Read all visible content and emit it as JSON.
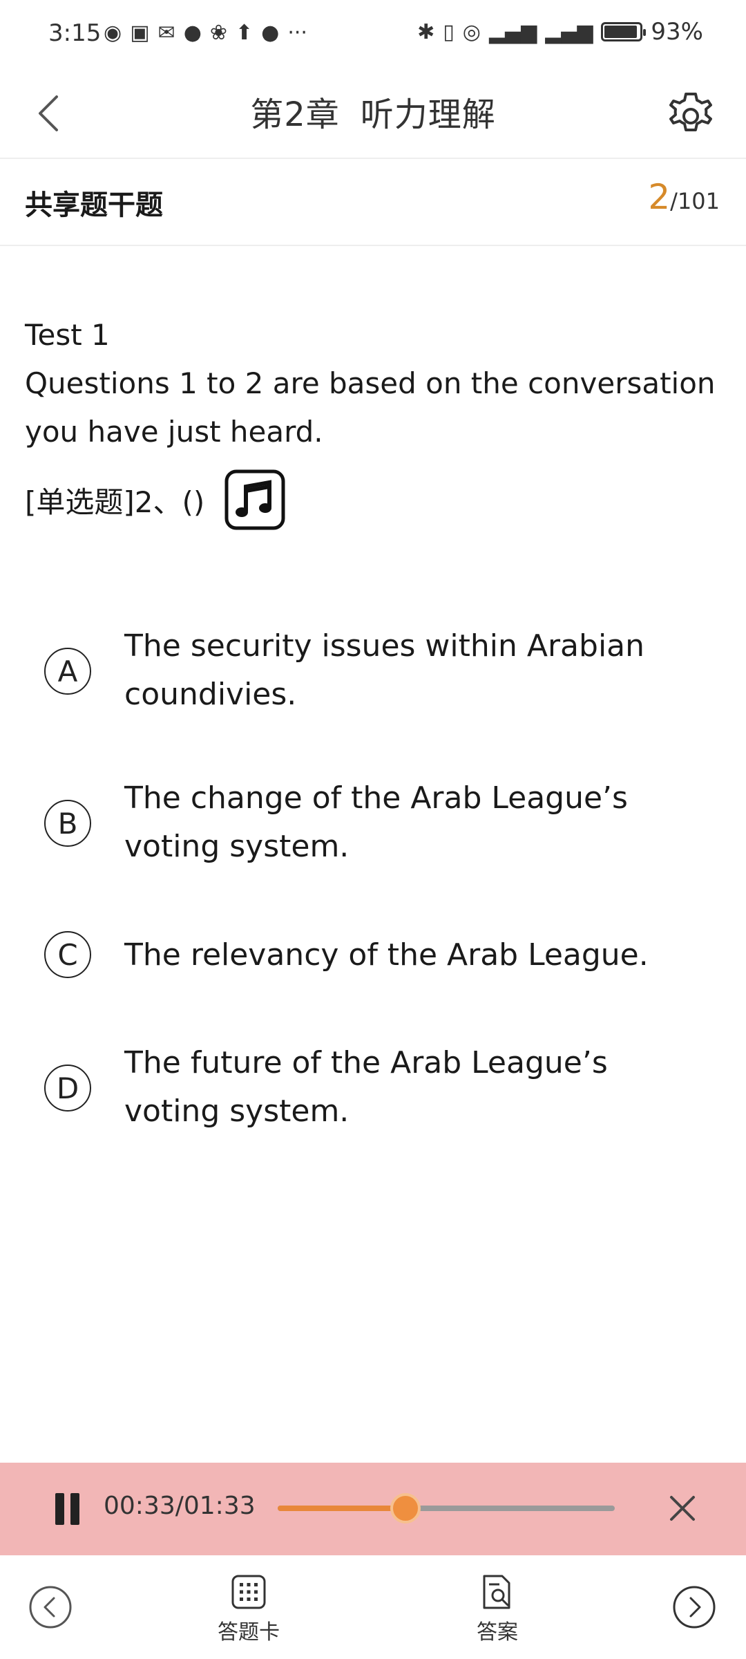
{
  "status_bar": {
    "time": "3:15",
    "more": "···",
    "battery_percent": "93%",
    "battery_level": 0.93
  },
  "header": {
    "chapter": "第2章",
    "title": "听力理解"
  },
  "section": {
    "title": "共享题干题",
    "current": "2",
    "total": "/101"
  },
  "question": {
    "test_label": "Test 1",
    "stem": "Questions 1 to 2 are based on the conversation you have just heard.",
    "type_label": "[单选题]2、()"
  },
  "options": [
    {
      "letter": "A",
      "text": "The security issues within Arabian coundivies."
    },
    {
      "letter": "B",
      "text": "The change of the Arab League’s voting system."
    },
    {
      "letter": "C",
      "text": "The relevancy of the Arab League."
    },
    {
      "letter": "D",
      "text": "The future of the Arab League’s voting system."
    }
  ],
  "player": {
    "time": "00:33/01:33",
    "progress_fraction": 0.3785
  },
  "bottom_nav": {
    "answer_card": "答题卡",
    "answer": "答案"
  },
  "colors": {
    "accent": "#d68a2a",
    "player_bg": "#f2b6b6",
    "progress": "#e8873a"
  }
}
